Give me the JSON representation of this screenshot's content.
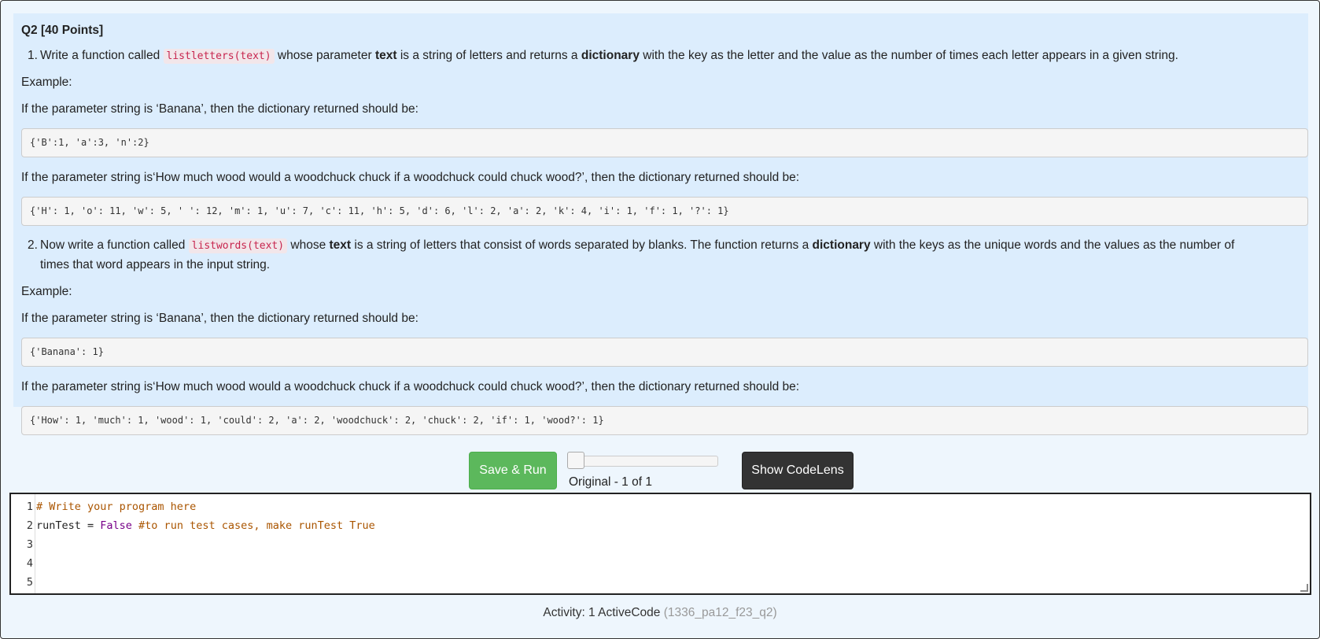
{
  "question": {
    "title": "Q2 [40 Points]",
    "item1": {
      "num": "1.",
      "pre": "Write a function called ",
      "func": "listletters(text)",
      "mid1": " whose parameter ",
      "param": "text",
      "mid2": " is a string of letters and returns a ",
      "dict": "dictionary",
      "post": " with the key as the letter and the value as the number of times each letter appears in a given string."
    },
    "example1_label": "Example:",
    "example1_line1": "If the parameter string is ‘Banana’, then the dictionary returned should be:",
    "example1_code1": "{'B':1, 'a':3, 'n':2}",
    "example1_line2": "If the parameter string is‘How much wood would a woodchuck chuck if a woodchuck could chuck wood?’, then the dictionary returned should be:",
    "example1_code2": "{'H': 1, 'o': 11, 'w': 5, ' ': 12, 'm': 1, 'u': 7, 'c': 11, 'h': 5, 'd': 6, 'l': 2, 'a': 2, 'k': 4, 'i': 1, 'f': 1, '?': 1}",
    "item2": {
      "num": "2.",
      "pre": "Now write a function called ",
      "func": "listwords(text)",
      "mid1": " whose ",
      "param": "text",
      "mid2": " is a string of letters that consist of words separated by blanks. The function returns a ",
      "dict": "dictionary",
      "post": " with the keys as the unique words and the values as the number of",
      "line2": "times that word appears in the input string."
    },
    "example2_label": "Example:",
    "example2_line1": "If the parameter string is ‘Banana’, then the dictionary returned should be:",
    "example2_code1": "{'Banana': 1}",
    "example2_line2": "If the parameter string is‘How much wood would a woodchuck chuck if a woodchuck could chuck wood?’, then the dictionary returned should be:",
    "example2_code2": "{'How': 1, 'much': 1, 'wood': 1, 'could': 2, 'a': 2, 'woodchuck': 2, 'chuck': 2, 'if': 1, 'wood?': 1}"
  },
  "controls": {
    "save_run_label": "Save & Run",
    "version_label": "Original - 1 of 1",
    "codelens_label": "Show CodeLens"
  },
  "editor": {
    "line_numbers": [
      "1",
      "2",
      "3",
      "4",
      "5"
    ],
    "line1_comment": "# Write your program here",
    "line2_var": "runTest = ",
    "line2_kw": "False",
    "line2_comment": " #to run test cases, make runTest True"
  },
  "activity": {
    "label": "Activity: 1 ActiveCode ",
    "id": "(1336_pa12_f23_q2)"
  },
  "colors": {
    "question_bg": "#dcedfd",
    "page_bg": "#eef6fd",
    "run_button": "#5cb85c",
    "codelens_button": "#333333",
    "inline_code": "#c7254e"
  }
}
